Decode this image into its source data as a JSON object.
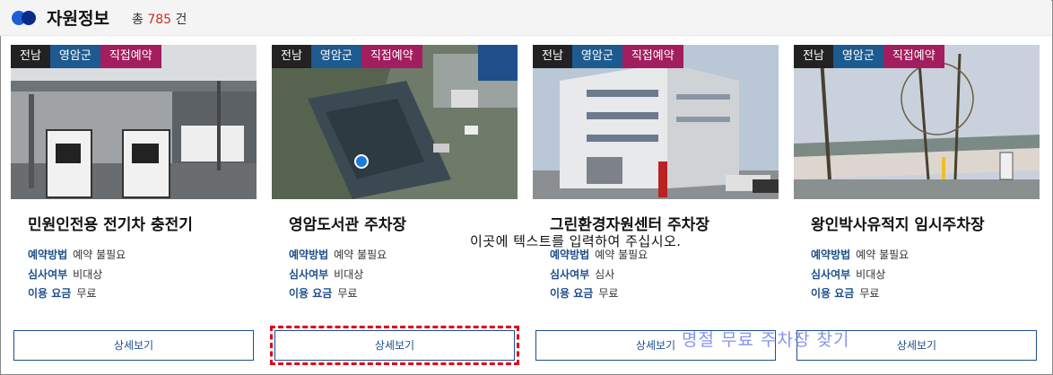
{
  "header": {
    "title": "자원정보",
    "count_prefix": "총",
    "count_value": "785",
    "count_suffix": "건",
    "logo_icon": "two-circles-logo"
  },
  "colors": {
    "tag_region": "#222222",
    "tag_county": "#1d5a8f",
    "tag_booking": "#a31e5e",
    "label_blue": "#1d4f8c",
    "count_red": "#c8321f"
  },
  "cards": [
    {
      "tags": [
        "전남",
        "영암군",
        "직접예약"
      ],
      "name": "민원인전용 전기차 충전기",
      "rows": [
        {
          "key": "예약방법",
          "value": "예약 불필요"
        },
        {
          "key": "심사여부",
          "value": "비대상"
        },
        {
          "key": "이용 요금",
          "value": "무료"
        }
      ],
      "button": "상세보기"
    },
    {
      "tags": [
        "전남",
        "영암군",
        "직접예약"
      ],
      "name": "영암도서관 주차장",
      "rows": [
        {
          "key": "예약방법",
          "value": "예약 불필요"
        },
        {
          "key": "심사여부",
          "value": "비대상"
        },
        {
          "key": "이용 요금",
          "value": "무료"
        }
      ],
      "button": "상세보기"
    },
    {
      "tags": [
        "전남",
        "영암군",
        "직접예약"
      ],
      "name": "그린환경자원센터 주차장",
      "rows": [
        {
          "key": "예약방법",
          "value": "예약 불필요"
        },
        {
          "key": "심사여부",
          "value": "심사"
        },
        {
          "key": "이용 요금",
          "value": "무료"
        }
      ],
      "button": "상세보기"
    },
    {
      "tags": [
        "전남",
        "영암군",
        "직접예약"
      ],
      "name": "왕인박사유적지 임시주차장",
      "rows": [
        {
          "key": "예약방법",
          "value": "예약 불필요"
        },
        {
          "key": "심사여부",
          "value": "비대상"
        },
        {
          "key": "이용 요금",
          "value": "무료"
        }
      ],
      "button": "상세보기"
    }
  ],
  "overlays": {
    "placeholder_text": "이곳에 텍스트를 입력하여 주십시오.",
    "watermark_text": "명절 무료 주차장 찾기"
  }
}
